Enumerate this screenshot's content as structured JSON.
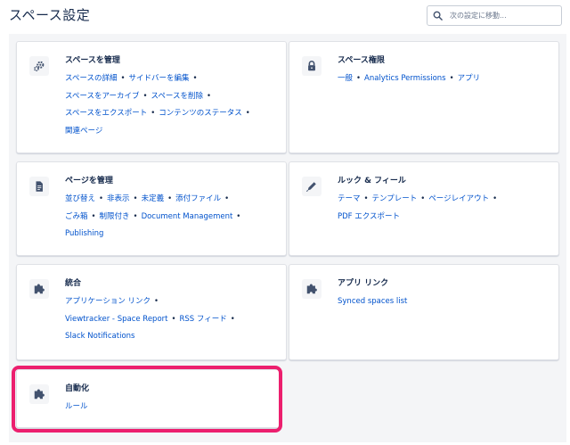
{
  "header": {
    "title": "スペース設定",
    "search_placeholder": "次の設定に移動..."
  },
  "cards": [
    {
      "id": "manage-space",
      "icon": "gears-icon",
      "title": "スペースを管理",
      "lines": [
        [
          "スペースの詳細",
          "サイドバーを編集"
        ],
        [
          "スペースをアーカイブ",
          "スペースを削除"
        ],
        [
          "スペースをエクスポート",
          "コンテンツのステータス"
        ],
        [
          "関連ページ"
        ]
      ]
    },
    {
      "id": "space-permissions",
      "icon": "lock-icon",
      "title": "スペース権限",
      "lines": [
        [
          "一般",
          "Analytics Permissions",
          "アプリ"
        ]
      ]
    },
    {
      "id": "manage-pages",
      "icon": "document-icon",
      "title": "ページを管理",
      "lines": [
        [
          "並び替え",
          "非表示",
          "未定義",
          "添付ファイル"
        ],
        [
          "ごみ箱",
          "制限付き",
          "Document Management"
        ],
        [
          "Publishing"
        ]
      ]
    },
    {
      "id": "look-and-feel",
      "icon": "pencil-icon",
      "title": "ルック & フィール",
      "lines": [
        [
          "テーマ",
          "テンプレート",
          "ページレイアウト"
        ],
        [
          "PDF エクスポート"
        ]
      ]
    },
    {
      "id": "integrations",
      "icon": "puzzle-icon",
      "title": "統合",
      "lines": [
        [
          "アプリケーション リンク"
        ],
        [
          "Viewtracker - Space Report",
          "RSS フィード"
        ],
        [
          "Slack Notifications"
        ]
      ]
    },
    {
      "id": "app-links",
      "icon": "puzzle-icon",
      "title": "アプリ リンク",
      "lines": [
        [
          "Synced spaces list"
        ]
      ]
    },
    {
      "id": "automation",
      "icon": "puzzle-icon",
      "title": "自動化",
      "lines": [
        [
          "ルール"
        ]
      ]
    }
  ],
  "colors": {
    "link": "#0052cc",
    "text": "#172b4d",
    "background": "#f4f5f7",
    "highlight": "#ec1f6e"
  }
}
